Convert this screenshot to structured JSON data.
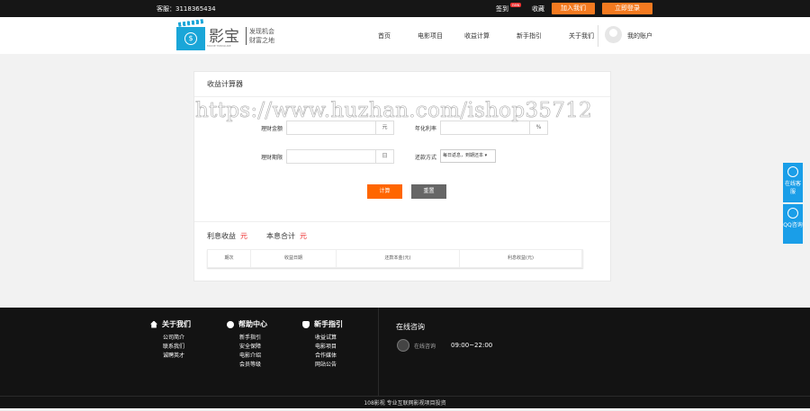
{
  "topbar": {
    "phone": "客服：3118365434",
    "sign_in": "签到",
    "badge": "new",
    "favorite": "收藏",
    "join": "加入我们",
    "login": "立即登录"
  },
  "logo": {
    "name": "影宝",
    "english": "MOVIE TREASURE",
    "slogan1": "发现机会",
    "slogan2": "财富之地"
  },
  "nav": [
    "首页",
    "电影项目",
    "收益计算",
    "新手指引",
    "关于我们"
  ],
  "account": "我的账户",
  "calculator": {
    "title": "收益计算器",
    "watermark": "https://www.huzhan.com/ishop35712",
    "amount_label": "理财金额",
    "amount_unit": "元",
    "rate_label": "年化利率",
    "rate_unit": "%",
    "term_label": "理财期限",
    "term_unit": "日",
    "repay_label": "还款方式",
    "repay_value": "每日返息，到期还本",
    "calc_button": "计算",
    "reset_button": "重置",
    "interest_label": "利息收益",
    "interest_unit": "元",
    "total_label": "本息合计",
    "total_unit": "元",
    "columns": [
      "期次",
      "收益日期",
      "还款本金(元)",
      "利息收益(元)"
    ]
  },
  "side": {
    "online_service": "在线客服",
    "qq": "QQ咨询"
  },
  "footer": {
    "cols": [
      {
        "title": "关于我们",
        "items": [
          "公司简介",
          "联系我们",
          "诚聘英才"
        ]
      },
      {
        "title": "帮助中心",
        "items": [
          "新手指引",
          "安全保障",
          "电影介绍",
          "会员等级"
        ]
      },
      {
        "title": "新手指引",
        "items": [
          "收益试算",
          "电影项目",
          "合作媒体",
          "网站公告"
        ]
      }
    ],
    "online_title": "在线咨询",
    "online_link": "在线咨询",
    "hours": "09:00~22:00",
    "bottom": "108影视 专业互联网影视项目投资"
  }
}
